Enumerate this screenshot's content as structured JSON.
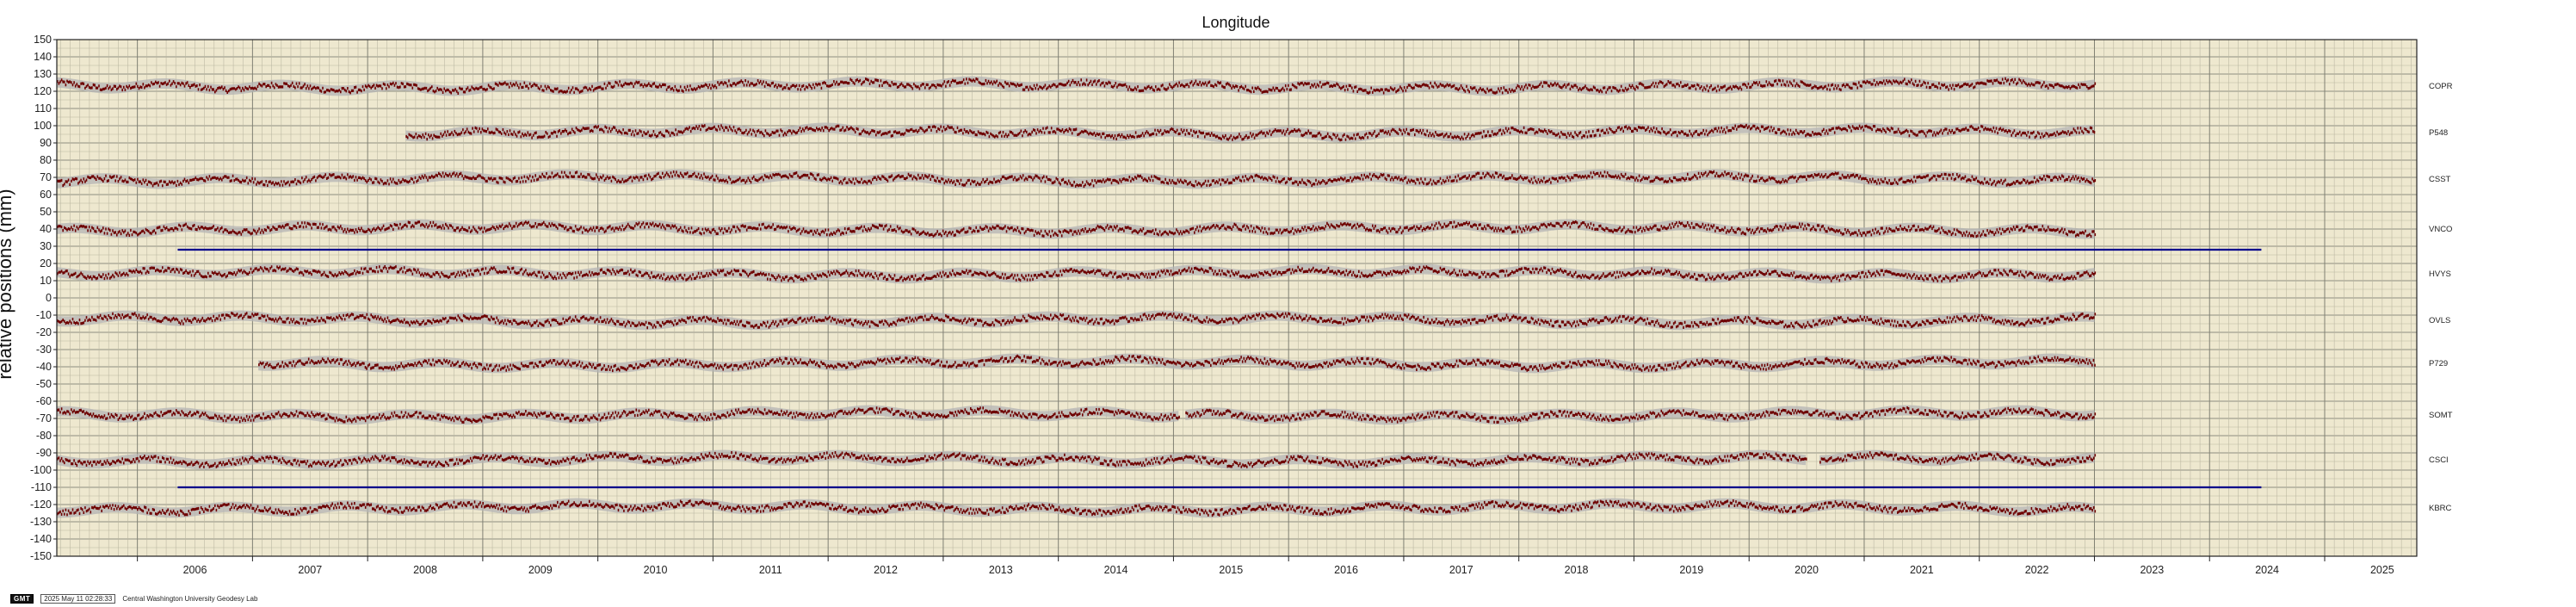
{
  "chart_data": {
    "type": "scatter",
    "title": "Longitude",
    "ylabel": "relative positions (mm)",
    "xlabel": "",
    "xlim": [
      2005.3,
      2025.8
    ],
    "ylim": [
      -150,
      150
    ],
    "y_ticks": [
      150,
      140,
      130,
      120,
      110,
      100,
      90,
      80,
      70,
      60,
      50,
      40,
      30,
      20,
      10,
      0,
      -10,
      -20,
      -30,
      -40,
      -50,
      -60,
      -70,
      -80,
      -90,
      -100,
      -110,
      -120,
      -130,
      -140,
      -150
    ],
    "x_ticks": [
      "2006",
      "2007",
      "2008",
      "2009",
      "2010",
      "2011",
      "2012",
      "2013",
      "2014",
      "2015",
      "2016",
      "2017",
      "2018",
      "2019",
      "2020",
      "2021",
      "2022",
      "2023",
      "2024",
      "2025"
    ],
    "grid": true,
    "background_color": "#eee8cf",
    "point_color": "#6e0000",
    "uncertainty_color": "#b4b4b4",
    "event_line_color": "#00008b",
    "series": [
      {
        "name": "COPR",
        "offset": 123,
        "start": 2005.3,
        "end": 2023.0,
        "gaps": []
      },
      {
        "name": "P548",
        "offset": 96,
        "start": 2008.33,
        "end": 2023.0,
        "gaps": []
      },
      {
        "name": "CSST",
        "offset": 69,
        "start": 2005.3,
        "end": 2023.0,
        "gaps": []
      },
      {
        "name": "VNCO",
        "offset": 40,
        "start": 2005.3,
        "end": 2023.0,
        "gaps": []
      },
      {
        "name": "HVYS",
        "offset": 14,
        "start": 2005.3,
        "end": 2023.0,
        "gaps": []
      },
      {
        "name": "OVLS",
        "offset": -13,
        "start": 2005.3,
        "end": 2023.0,
        "gaps": []
      },
      {
        "name": "P729",
        "offset": -38,
        "start": 2007.05,
        "end": 2023.0,
        "gaps": []
      },
      {
        "name": "SOMT",
        "offset": -68,
        "start": 2005.3,
        "end": 2023.0,
        "gaps": [
          [
            2015.05,
            2015.1
          ]
        ]
      },
      {
        "name": "CSCI",
        "offset": -94,
        "start": 2005.3,
        "end": 2023.0,
        "gaps": [
          [
            2020.5,
            2020.6
          ]
        ]
      },
      {
        "name": "KBRC",
        "offset": -122,
        "start": 2005.3,
        "end": 2023.0,
        "gaps": []
      }
    ],
    "event_lines": [
      {
        "y": 28,
        "x_start": 2006.35,
        "x_end": 2024.45
      },
      {
        "y": -110,
        "x_start": 2006.35,
        "x_end": 2024.45
      }
    ]
  },
  "footer": {
    "badge": "GMT",
    "timestamp": "2025 May 11 02:28:33",
    "lab": "Central Washington University Geodesy Lab"
  }
}
